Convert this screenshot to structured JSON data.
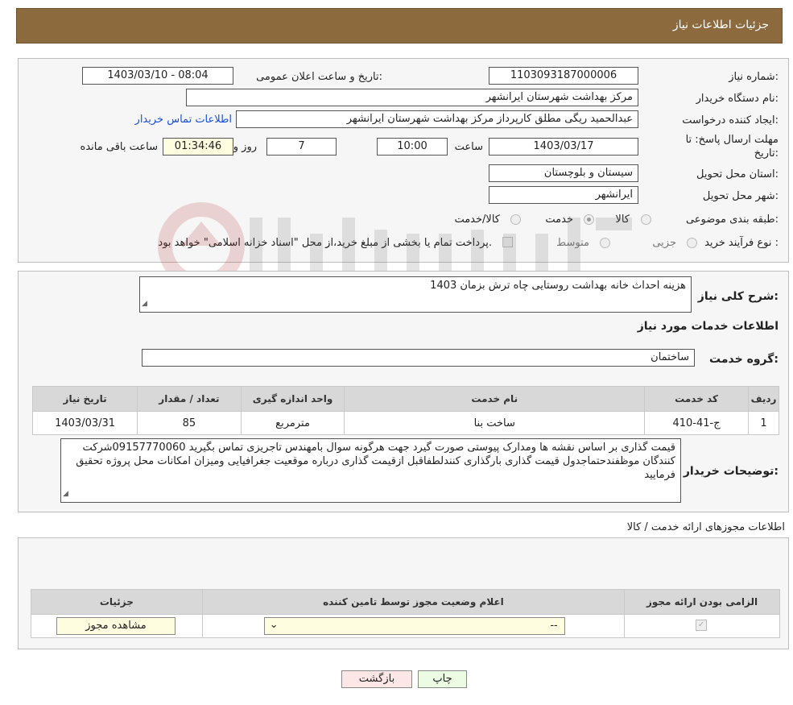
{
  "header": {
    "title": "جزئیات اطلاعات نیاز"
  },
  "form": {
    "need_number_label": "شماره نیاز:",
    "need_number": "1103093187000006",
    "announce_label": "تاریخ و ساعت اعلان عمومی:",
    "announce_value": "1403/03/10 - 08:04",
    "buyer_org_label": "نام دستگاه خریدار:",
    "buyer_org": "مرکز بهداشت شهرستان ایرانشهر",
    "creator_label": "ایجاد کننده درخواست:",
    "creator": "عبدالحمید ریگی مطلق کارپرداز مرکز بهداشت شهرستان ایرانشهر",
    "contact_link": "اطلاعات تماس خریدار",
    "deadline_label_1": "مهلت ارسال پاسخ: تا",
    "deadline_label_2": "تاریخ:",
    "deadline_date": "1403/03/17",
    "time_label": "ساعت",
    "deadline_time": "10:00",
    "days_value": "7",
    "days_label": "روز و",
    "remaining_time": "01:34:46",
    "remaining_label": "ساعت باقی مانده",
    "province_label": "استان محل تحویل:",
    "province": "سیستان و بلوچستان",
    "city_label": "شهر محل تحویل:",
    "city": "ایرانشهر",
    "category_label": "طبقه بندی موضوعی:",
    "category_options": [
      "کالا",
      "خدمت",
      "کالا/خدمت"
    ],
    "category_selected": "خدمت",
    "process_label": "نوع فرآیند خرید :",
    "process_options": [
      "جزیی",
      "متوسط"
    ],
    "process_note": "پرداخت تمام یا بخشی از مبلغ خرید،از محل \"اسناد خزانه اسلامی\" خواهد بود."
  },
  "details": {
    "summary_label": "شرح کلی نیاز:",
    "summary": "هزینه احداث خانه بهداشت روستایی چاه ترش بزمان 1403",
    "services_title": "اطلاعات خدمات مورد نیاز",
    "service_group_label": "گروه خدمت:",
    "service_group": "ساختمان",
    "table_headers": [
      "ردیف",
      "کد خدمت",
      "نام خدمت",
      "واحد اندازه گیری",
      "تعداد / مقدار",
      "تاریخ نیاز"
    ],
    "table_rows": [
      {
        "row": "1",
        "code": "ج-41-410",
        "name": "ساخت بنا",
        "unit": "مترمربع",
        "qty": "85",
        "date": "1403/03/31"
      }
    ],
    "buyer_notes_label": "توضیحات خریدار:",
    "buyer_notes": "قیمت گذاری بر اساس نقشه ها ومدارک پیوستی صورت گیرد جهت هرگونه سوال بامهندس تاجریزی تماس بگیرید 09157770060شرکت کنندگان موظفندحتماجدول قیمت گذاری بارگذاری کنندلطفاقبل ازقیمت گذاری درباره موقعیت جغرافیایی ومیزان امکانات محل پروژه تحقیق فرمایید"
  },
  "permits": {
    "title": "اطلاعات مجوزهای ارائه خدمت / کالا",
    "headers": [
      "الزامی بودن ارائه مجوز",
      "اعلام وضعیت مجوز توسط تامین کننده",
      "جزئیات"
    ],
    "select_value": "--",
    "view_button": "مشاهده مجوز"
  },
  "buttons": {
    "print": "چاپ",
    "back": "بازگشت"
  },
  "colors": {
    "header_bg": "#8c6a3e",
    "link": "#1a4fd6",
    "timer_bg": "#fffde0",
    "back_bg": "#fde6e6",
    "print_bg": "#ecfbe4"
  }
}
